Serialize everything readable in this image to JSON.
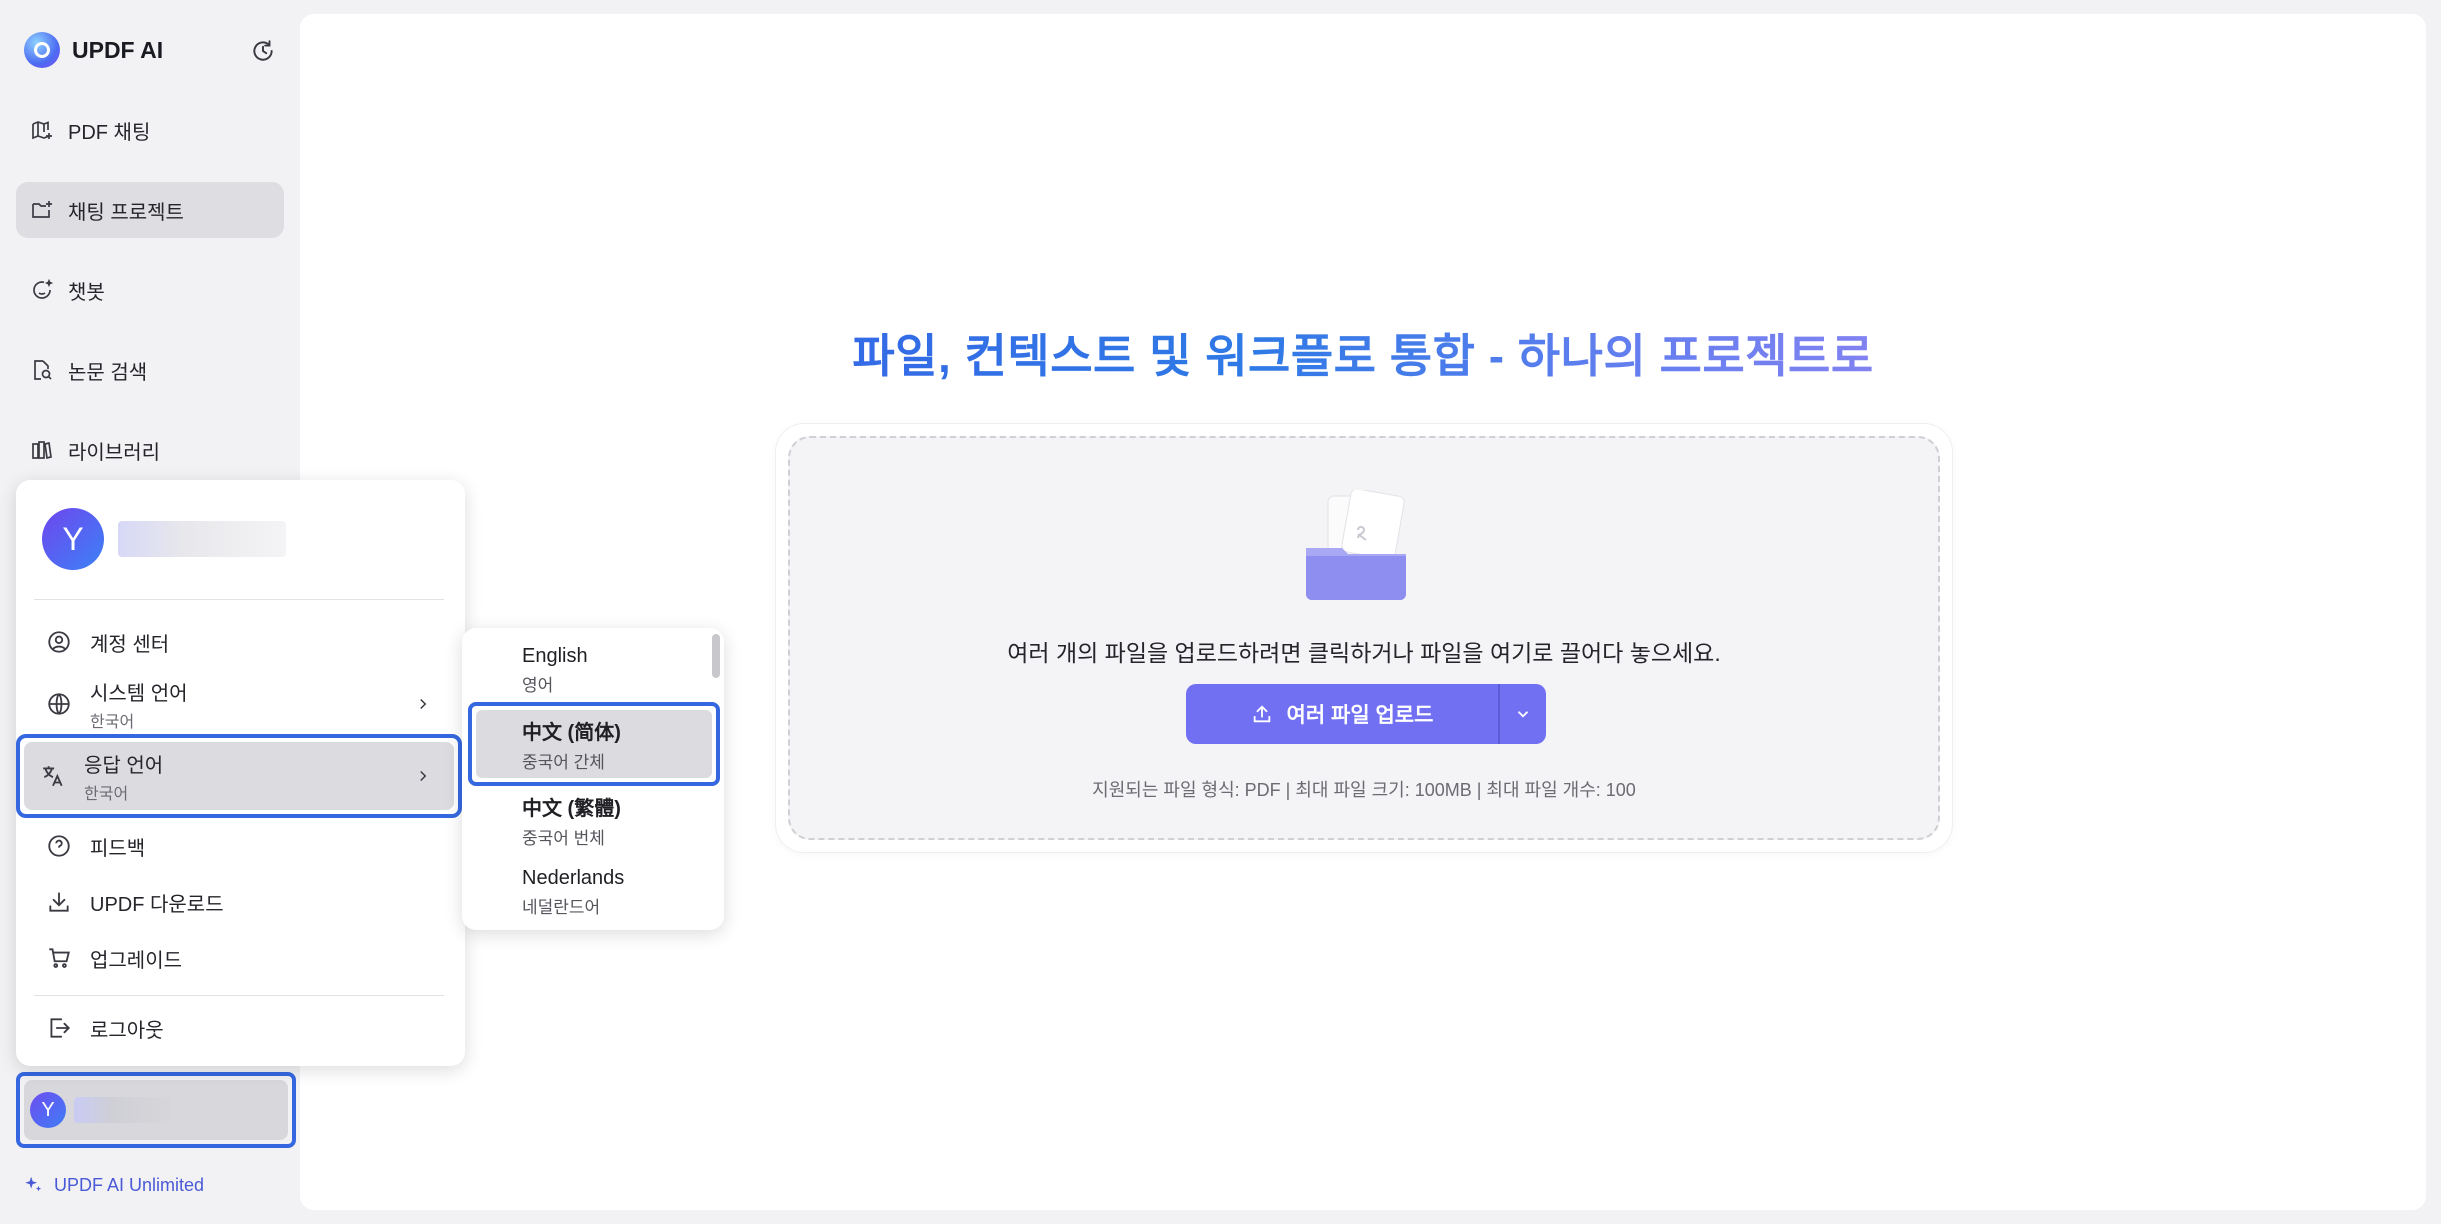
{
  "sidebar": {
    "brand": "UPDF AI",
    "nav": [
      {
        "label": "PDF 채팅",
        "icon": "map-plus-icon"
      },
      {
        "label": "채팅 프로젝트",
        "icon": "folder-plus-icon"
      },
      {
        "label": "챗봇",
        "icon": "smile-sparkle-icon"
      },
      {
        "label": "논문 검색",
        "icon": "doc-search-icon"
      },
      {
        "label": "라이브러리",
        "icon": "library-books-icon"
      }
    ],
    "user_initial": "Y",
    "plan_label": "UPDF AI Unlimited"
  },
  "main": {
    "headline": "파일, 컨텍스트 및 워크플로 통합 - 하나의 프로젝트로",
    "drop_text": "여러 개의 파일을 업로드하려면 클릭하거나 파일을 여기로 끌어다 놓으세요.",
    "upload_button": "여러 파일 업로드",
    "info": "지원되는 파일 형식: PDF | 최대 파일 크기: 100MB | 최대 파일 개수: 100"
  },
  "account_menu": {
    "avatar_initial": "Y",
    "items": {
      "account_center": "계정 센터",
      "system_language": "시스템 언어",
      "system_language_value": "한국어",
      "response_language": "응답 언어",
      "response_language_value": "한국어",
      "feedback": "피드백",
      "download": "UPDF 다운로드",
      "upgrade": "업그레이드",
      "logout": "로그아웃"
    }
  },
  "language_menu": {
    "options": [
      {
        "name": "English",
        "native": "영어"
      },
      {
        "name": "中文 (简体)",
        "native": "중국어 간체"
      },
      {
        "name": "中文 (繁體)",
        "native": "중국어 번체"
      },
      {
        "name": "Nederlands",
        "native": "네덜란드어"
      }
    ],
    "selected_index": 1
  },
  "colors": {
    "accent": "#7170f3",
    "highlight_border": "#3568e0",
    "plan_text": "#4a5ad6"
  }
}
